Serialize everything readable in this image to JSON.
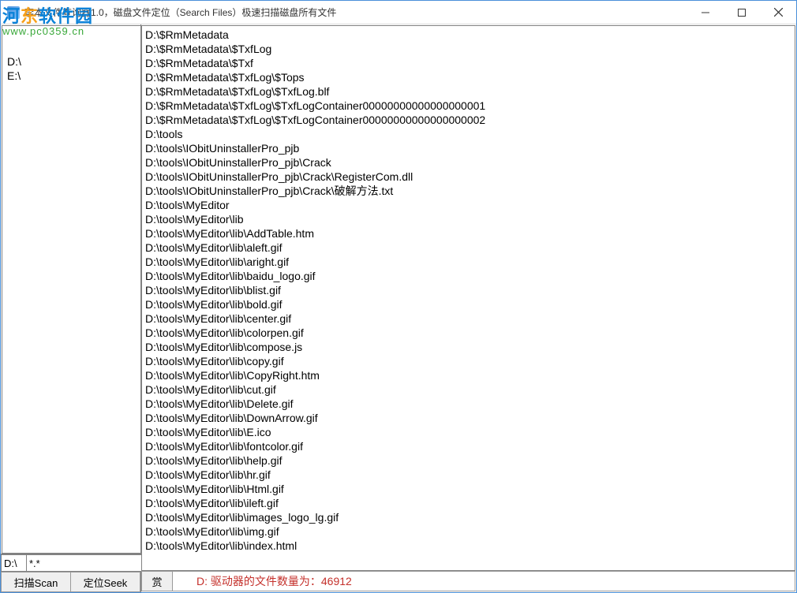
{
  "window": {
    "title": "李本文件查询器1.0，磁盘文件定位（Search Files）极速扫描磁盘所有文件"
  },
  "watermark": {
    "brand_prefix": "河",
    "brand_accent": "东",
    "brand_suffix": "软件园",
    "url": "www.pc0359.cn"
  },
  "drives": [
    "D:\\",
    "E:\\"
  ],
  "path_input": "D:\\",
  "pattern_input": "*.*",
  "buttons": {
    "scan": "扫描Scan",
    "seek": "定位Seek",
    "reward": "赏"
  },
  "status": "D: 驱动器的文件数量为：46912",
  "files": [
    "D:\\$RmMetadata",
    "D:\\$RmMetadata\\$TxfLog",
    "D:\\$RmMetadata\\$Txf",
    "D:\\$RmMetadata\\$TxfLog\\$Tops",
    "D:\\$RmMetadata\\$TxfLog\\$TxfLog.blf",
    "D:\\$RmMetadata\\$TxfLog\\$TxfLogContainer00000000000000000001",
    "D:\\$RmMetadata\\$TxfLog\\$TxfLogContainer00000000000000000002",
    "D:\\tools",
    "D:\\tools\\IObitUninstallerPro_pjb",
    "D:\\tools\\IObitUninstallerPro_pjb\\Crack",
    "D:\\tools\\IObitUninstallerPro_pjb\\Crack\\RegisterCom.dll",
    "D:\\tools\\IObitUninstallerPro_pjb\\Crack\\破解方法.txt",
    "D:\\tools\\MyEditor",
    "D:\\tools\\MyEditor\\lib",
    "D:\\tools\\MyEditor\\lib\\AddTable.htm",
    "D:\\tools\\MyEditor\\lib\\aleft.gif",
    "D:\\tools\\MyEditor\\lib\\aright.gif",
    "D:\\tools\\MyEditor\\lib\\baidu_logo.gif",
    "D:\\tools\\MyEditor\\lib\\blist.gif",
    "D:\\tools\\MyEditor\\lib\\bold.gif",
    "D:\\tools\\MyEditor\\lib\\center.gif",
    "D:\\tools\\MyEditor\\lib\\colorpen.gif",
    "D:\\tools\\MyEditor\\lib\\compose.js",
    "D:\\tools\\MyEditor\\lib\\copy.gif",
    "D:\\tools\\MyEditor\\lib\\CopyRight.htm",
    "D:\\tools\\MyEditor\\lib\\cut.gif",
    "D:\\tools\\MyEditor\\lib\\Delete.gif",
    "D:\\tools\\MyEditor\\lib\\DownArrow.gif",
    "D:\\tools\\MyEditor\\lib\\E.ico",
    "D:\\tools\\MyEditor\\lib\\fontcolor.gif",
    "D:\\tools\\MyEditor\\lib\\help.gif",
    "D:\\tools\\MyEditor\\lib\\hr.gif",
    "D:\\tools\\MyEditor\\lib\\Html.gif",
    "D:\\tools\\MyEditor\\lib\\ileft.gif",
    "D:\\tools\\MyEditor\\lib\\images_logo_lg.gif",
    "D:\\tools\\MyEditor\\lib\\img.gif",
    "D:\\tools\\MyEditor\\lib\\index.html"
  ]
}
